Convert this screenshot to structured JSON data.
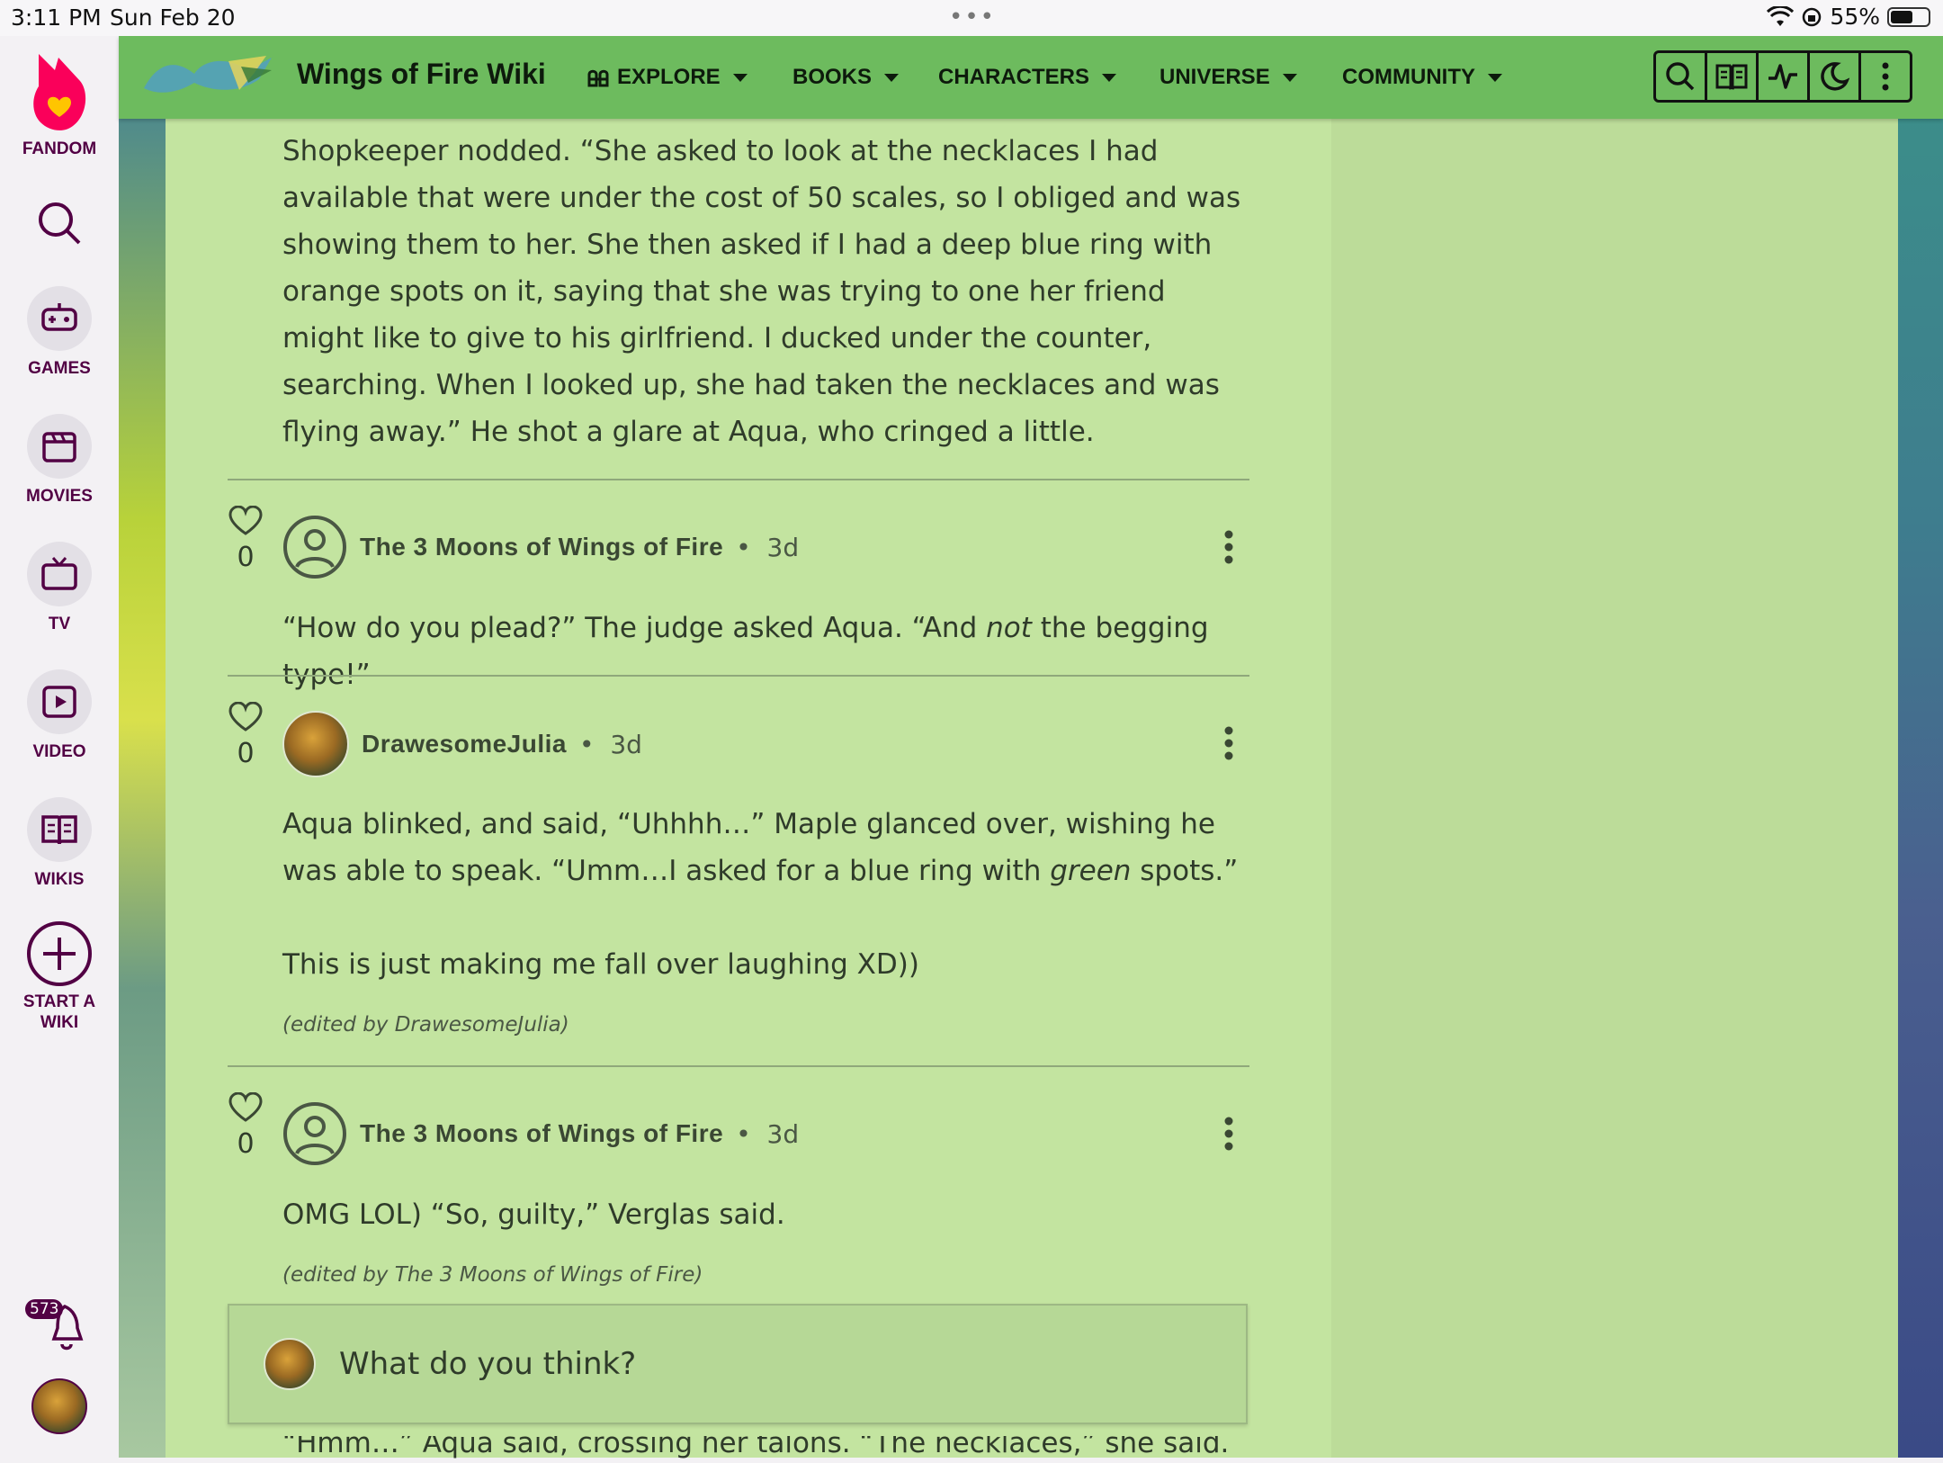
{
  "status_bar": {
    "time": "3:11 PM",
    "date": "Sun Feb 20",
    "battery": "55%"
  },
  "fandom_rail": {
    "logo_label": "FANDOM",
    "items": [
      {
        "label": "GAMES",
        "icon": "gamepad-icon"
      },
      {
        "label": "MOVIES",
        "icon": "clapperboard-icon"
      },
      {
        "label": "TV",
        "icon": "tv-icon"
      },
      {
        "label": "VIDEO",
        "icon": "play-icon"
      },
      {
        "label": "WIKIS",
        "icon": "book-icon"
      }
    ],
    "start_wiki_label": "START A WIKI",
    "notifications_count": "573"
  },
  "header": {
    "wiki_title": "Wings of Fire Wiki",
    "nav": [
      "EXPLORE",
      "BOOKS",
      "CHARACTERS",
      "UNIVERSE",
      "COMMUNITY"
    ],
    "tools": [
      "search-icon",
      "book-icon",
      "activity-icon",
      "moon-icon",
      "more-icon"
    ]
  },
  "thread": {
    "top_paragraph": "Shopkeeper nodded. “She asked to look at the necklaces I had available that were under the cost of 50 scales, so I obliged and was showing them to her. She then asked if I had a deep blue ring with orange spots on it, saying that she was trying to one her friend might like to give to his girlfriend. I ducked under the counter, searching. When I looked up, she had taken the necklaces and was flying away.” He shot a glare at Aqua, who cringed a little.",
    "replies": [
      {
        "likes": "0",
        "author": "The 3 Moons of Wings of Fire",
        "time": "3d",
        "body_pre": "“How do you plead?” The judge asked Aqua. “And ",
        "body_em": "not",
        "body_post": " the begging type!”"
      },
      {
        "likes": "0",
        "author": "DrawesomeJulia",
        "time": "3d",
        "body_pre": "Aqua blinked, and said, “Uhhhh…” Maple glanced over, wishing he was able to speak. “Umm…I asked for a blue ring with ",
        "body_em": "green",
        "body_post": " spots.”",
        "body_extra": "This is just making me fall over laughing XD))",
        "edited": "(edited by DrawesomeJulia)"
      },
      {
        "likes": "0",
        "author": "The 3 Moons of Wings of Fire",
        "time": "3d",
        "body": "OMG LOL) “So, guilty,” Verglas said.",
        "edited": "(edited by The 3 Moons of Wings of Fire)"
      }
    ],
    "reply_placeholder": "What do you think?",
    "cutoff_text": "“Hmm…” Aqua said, crossing her talons. “The necklaces,” she said. “Shopkeeper,”"
  }
}
